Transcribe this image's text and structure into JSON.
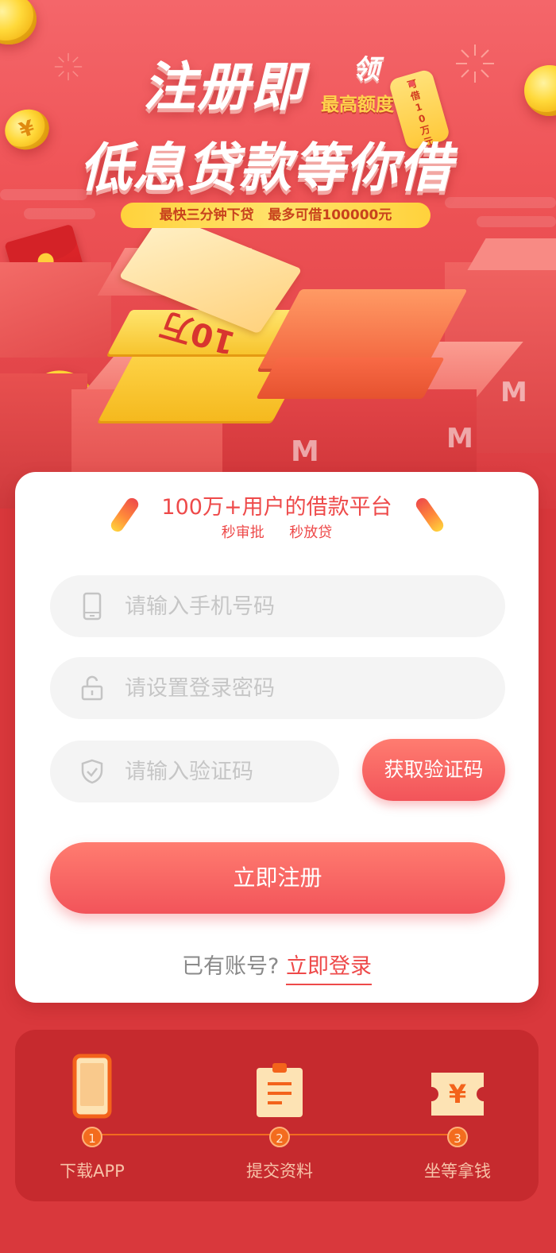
{
  "hero": {
    "headline_part1": "注册即",
    "headline_ling": "领",
    "headline_max": "最高额度",
    "headline_line2": "低息贷款等你借",
    "tag_text": "可借10万元",
    "banner": "最快三分钟下贷   最多可借100000元",
    "ticket_text": "10万",
    "coin_symbol": "¥"
  },
  "form": {
    "slogan": "100万+用户的借款平台",
    "slogan_sub": "秒审批  秒放贷",
    "phone_placeholder": "请输入手机号码",
    "password_placeholder": "请设置登录密码",
    "code_placeholder": "请输入验证码",
    "get_code_label": "获取验证码",
    "register_label": "立即注册",
    "have_account": "已有账号?",
    "login_label": "立即登录"
  },
  "steps": [
    {
      "num": "1",
      "label": "下载APP",
      "icon": "phone-icon"
    },
    {
      "num": "2",
      "label": "提交资料",
      "icon": "document-icon"
    },
    {
      "num": "3",
      "label": "坐等拿钱",
      "icon": "ticket-icon"
    }
  ],
  "colors": {
    "accent": "#ee4a4a",
    "button_top": "#ff7c70",
    "button_bottom": "#f2545a",
    "banner_yellow": "#ffd23c",
    "step_orange": "#f36c1e",
    "page_red": "#d9383c"
  }
}
